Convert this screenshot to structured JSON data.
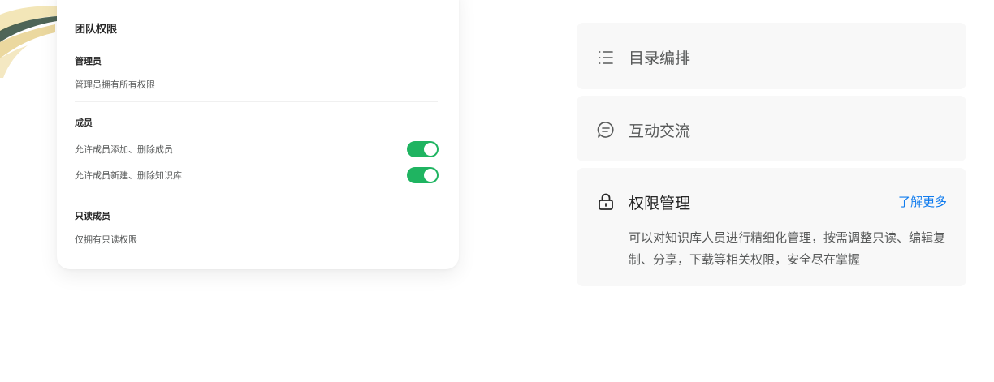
{
  "team_permissions": {
    "title": "团队权限",
    "sections": [
      {
        "title": "管理员",
        "description": "管理员拥有所有权限"
      },
      {
        "title": "成员",
        "options": [
          {
            "label": "允许成员添加、删除成员",
            "enabled": true
          },
          {
            "label": "允许成员新建、删除知识库",
            "enabled": true
          }
        ]
      },
      {
        "title": "只读成员",
        "description": "仅拥有只读权限"
      }
    ]
  },
  "features": [
    {
      "icon": "list-icon",
      "title": "目录编排"
    },
    {
      "icon": "chat-icon",
      "title": "互动交流"
    },
    {
      "icon": "lock-icon",
      "title": "权限管理",
      "link": "了解更多",
      "description": "可以对知识库人员进行精细化管理，按需调整只读、编辑复制、分享，下载等相关权限，安全尽在掌握"
    }
  ],
  "colors": {
    "toggle_on": "#1fb461",
    "link": "#117cee",
    "panel_bg": "#f8f8f8"
  }
}
